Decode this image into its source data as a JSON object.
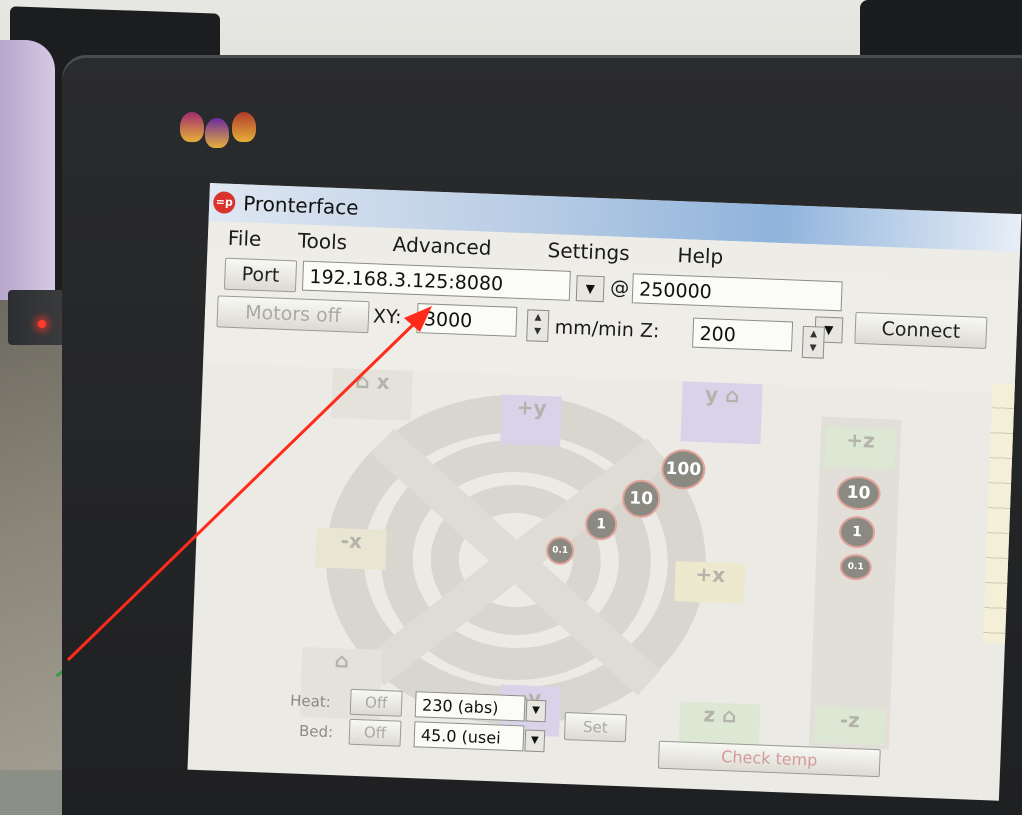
{
  "window": {
    "title": "Pronterface",
    "icon_text": "=p"
  },
  "menu": [
    "File",
    "Tools",
    "Advanced",
    "Settings",
    "Help"
  ],
  "connection": {
    "port_label": "Port",
    "port_value": "192.168.3.125:8080",
    "at_symbol": "@",
    "baud_value": "250000",
    "connect_label": "Connect"
  },
  "motion": {
    "motors_off_label": "Motors off",
    "xy_label": "XY:",
    "xy_value": "3000",
    "unit_label": "mm/min Z:",
    "z_value": "200"
  },
  "jog": {
    "home_x": "x",
    "home_y": "y",
    "home_z": "z",
    "plus_y": "+y",
    "minus_y": "-y",
    "plus_x": "+x",
    "minus_x": "-x",
    "plus_z": "+z",
    "minus_z": "-z",
    "steps_xy": [
      "0.1",
      "1",
      "10",
      "100"
    ],
    "steps_z": [
      "10",
      "1",
      "0.1"
    ]
  },
  "temps": {
    "heat_label": "Heat:",
    "heat_off": "Off",
    "heat_value": "230 (abs)",
    "bed_label": "Bed:",
    "bed_off": "Off",
    "bed_value": "45.0 (usei",
    "set_label": "Set",
    "check_temp_label": "Check temp"
  },
  "colors": {
    "accent_arrow": "#ff2a1a",
    "app_icon": "#d9332b"
  }
}
